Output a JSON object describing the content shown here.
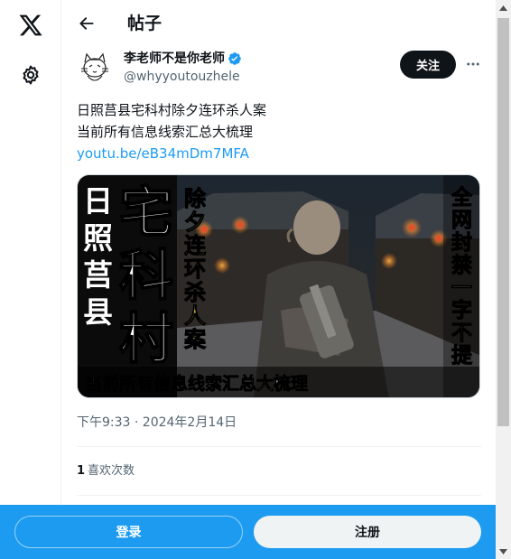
{
  "rail": {
    "logo_icon": "x-logo-icon",
    "settings_icon": "gear-icon"
  },
  "header": {
    "back_icon": "arrow-left-icon",
    "title": "帖子"
  },
  "author": {
    "display_name": "李老师不是你老师",
    "handle": "@whyyoutouzhele",
    "verified_icon": "verified-badge-icon",
    "follow_label": "关注",
    "more_icon": "more-dots-icon"
  },
  "tweet": {
    "line1": "日照莒县宅科村除夕连环杀人案",
    "line2": "当前所有信息线索汇总大梳理",
    "link": "youtu.be/eB34mDm7MFA"
  },
  "media": {
    "left_text": "日照莒县",
    "main_text": "宅科村",
    "sub_text": "除夕连环杀人案",
    "right_text": "全网封禁一字不提",
    "caption": "当前所有信息线索汇总大梳理"
  },
  "meta": {
    "timestamp": "下午9:33 · 2024年2月14日",
    "likes_count": "1",
    "likes_label": "喜欢次数"
  },
  "bottom": {
    "login_label": "登录",
    "signup_label": "注册"
  },
  "colors": {
    "accent": "#1d9bf0",
    "text": "#0f1419",
    "muted": "#536471",
    "verified": "#1d9bf0"
  }
}
